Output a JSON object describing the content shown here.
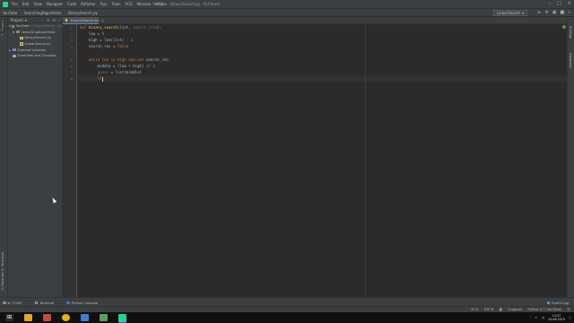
{
  "menu": {
    "items": [
      "File",
      "Edit",
      "View",
      "Navigate",
      "Code",
      "Refactor",
      "Run",
      "Tools",
      "VCS",
      "Window",
      "Help"
    ],
    "window_title": "YouTube - BinarySearch.py - PyCharm"
  },
  "navbar": {
    "breadcrumbs": [
      "YouTube",
      "SearchingAlgorithms",
      "BinarySearch.py"
    ],
    "run_config": "LinearSearch"
  },
  "left_strip": {
    "tabs": [
      "1: Project",
      "2: Structure",
      "2: Favorites"
    ]
  },
  "right_strip": {
    "tabs": [
      "SciView",
      "Database"
    ]
  },
  "project_panel": {
    "title": "Project",
    "root": {
      "label": "YouTube",
      "path": "C:\\Users\\Saruf...\\Py"
    },
    "folder": "SearchingAlgorithms",
    "files": [
      "BinarySearch.py",
      "LinearSearch.py"
    ],
    "external": "External Libraries",
    "scratches": "Scratches and Consoles"
  },
  "editor": {
    "tab_label": "BinarySearch.py",
    "line_numbers": [
      "1",
      "2",
      "3",
      "4",
      "5",
      "6",
      "7",
      "8"
    ],
    "code": {
      "l1_kw": "def ",
      "l1_fn": "binary_search",
      "l1_open": "(list, ",
      "l1_hint": "search_item",
      "l1_close": "):",
      "l2": "    low = ",
      "l2_num": "0",
      "l3": "    high = len(list) - ",
      "l3_num": "1",
      "l4": "    search_res = ",
      "l4_kw": "False",
      "l6_a": "    while low <= high ",
      "l6_kw1": "and not",
      "l6_b": " search_res:",
      "l7_a": "        middle = (low + high) // ",
      "l7_num": "2",
      "l8_a": "        ",
      "l8_warn": "guess",
      "l8_b": " = list[middle]",
      "l9_a": "        ",
      "l9_kw": "if"
    }
  },
  "bottom_tabs": {
    "todo": "6: TODO",
    "terminal": "Terminal",
    "python_console": "Python Console",
    "event_log": "Event Log"
  },
  "status": {
    "position": "8:11",
    "encoding": "UTF-8",
    "indent": "4 spaces",
    "interpreter": "Python 3.7 (YouTube)"
  },
  "taskbar": {
    "time": "14:37",
    "date": "20.06.2019"
  },
  "colors": {
    "keyword": "#cc7832",
    "function": "#ffc66d",
    "number": "#6897bb",
    "text": "#a9b7c6"
  }
}
